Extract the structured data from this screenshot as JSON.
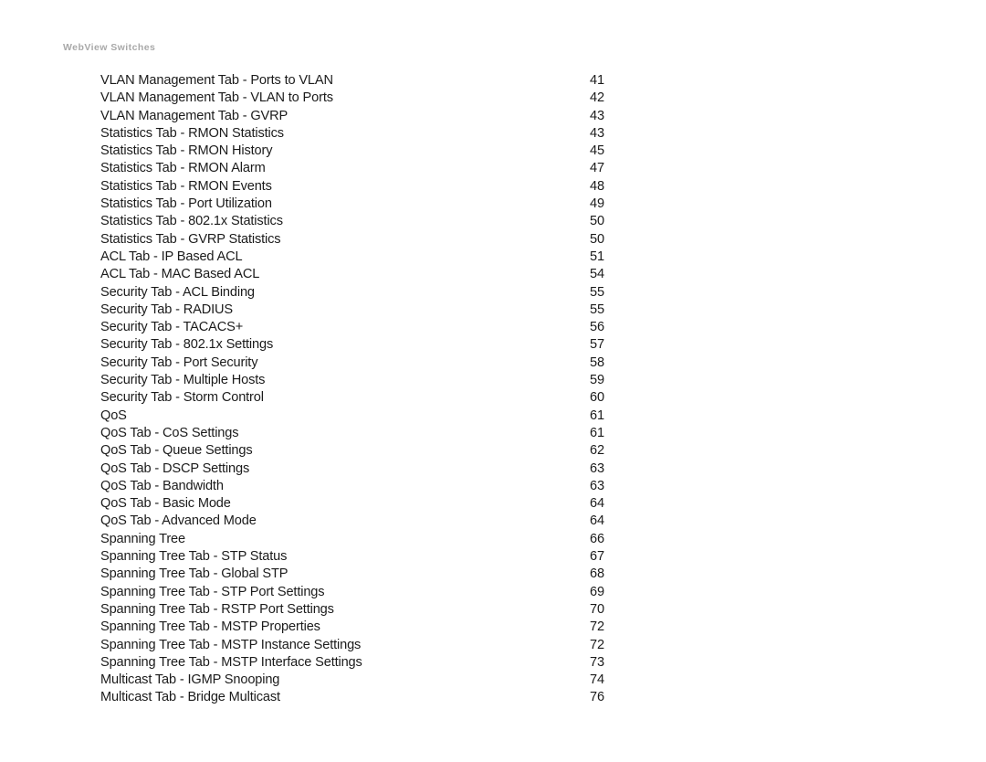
{
  "document": {
    "running_header": "WebView Switches",
    "header_color": "#a9a9a9",
    "text_color": "#1b1b1b",
    "background_color": "#ffffff"
  },
  "toc": {
    "entries": [
      {
        "title": "VLAN Management Tab - Ports to VLAN",
        "page": "41"
      },
      {
        "title": "VLAN Management Tab - VLAN to Ports",
        "page": "42"
      },
      {
        "title": "VLAN Management Tab - GVRP",
        "page": "43"
      },
      {
        "title": "Statistics Tab - RMON Statistics",
        "page": "43"
      },
      {
        "title": "Statistics Tab - RMON History",
        "page": "45"
      },
      {
        "title": "Statistics Tab - RMON Alarm",
        "page": "47"
      },
      {
        "title": "Statistics Tab - RMON Events",
        "page": "48"
      },
      {
        "title": "Statistics Tab - Port Utilization",
        "page": "49"
      },
      {
        "title": "Statistics Tab - 802.1x Statistics",
        "page": "50"
      },
      {
        "title": "Statistics Tab - GVRP Statistics",
        "page": "50"
      },
      {
        "title": "ACL Tab - IP Based ACL",
        "page": "51"
      },
      {
        "title": "ACL Tab - MAC Based ACL",
        "page": "54"
      },
      {
        "title": "Security Tab - ACL Binding",
        "page": "55"
      },
      {
        "title": "Security Tab - RADIUS",
        "page": "55"
      },
      {
        "title": "Security Tab - TACACS+",
        "page": "56"
      },
      {
        "title": "Security Tab - 802.1x Settings",
        "page": "57"
      },
      {
        "title": "Security Tab - Port Security",
        "page": "58"
      },
      {
        "title": "Security Tab - Multiple Hosts",
        "page": "59"
      },
      {
        "title": "Security Tab - Storm Control",
        "page": "60"
      },
      {
        "title": "QoS",
        "page": "61"
      },
      {
        "title": "QoS Tab - CoS Settings",
        "page": "61"
      },
      {
        "title": "QoS Tab - Queue Settings",
        "page": "62"
      },
      {
        "title": "QoS Tab - DSCP Settings",
        "page": "63"
      },
      {
        "title": "QoS Tab - Bandwidth",
        "page": "63"
      },
      {
        "title": "QoS Tab - Basic Mode",
        "page": "64"
      },
      {
        "title": "QoS Tab - Advanced Mode",
        "page": "64"
      },
      {
        "title": "Spanning Tree",
        "page": "66"
      },
      {
        "title": "Spanning Tree Tab - STP Status",
        "page": "67"
      },
      {
        "title": "Spanning Tree Tab - Global STP",
        "page": "68"
      },
      {
        "title": "Spanning Tree Tab - STP Port Settings",
        "page": "69"
      },
      {
        "title": "Spanning Tree Tab - RSTP Port Settings",
        "page": "70"
      },
      {
        "title": "Spanning Tree Tab - MSTP Properties",
        "page": "72"
      },
      {
        "title": "Spanning Tree Tab - MSTP Instance Settings",
        "page": "72"
      },
      {
        "title": "Spanning Tree Tab - MSTP Interface Settings",
        "page": "73"
      },
      {
        "title": "Multicast Tab - IGMP Snooping",
        "page": "74"
      },
      {
        "title": "Multicast Tab - Bridge Multicast",
        "page": "76"
      }
    ]
  }
}
